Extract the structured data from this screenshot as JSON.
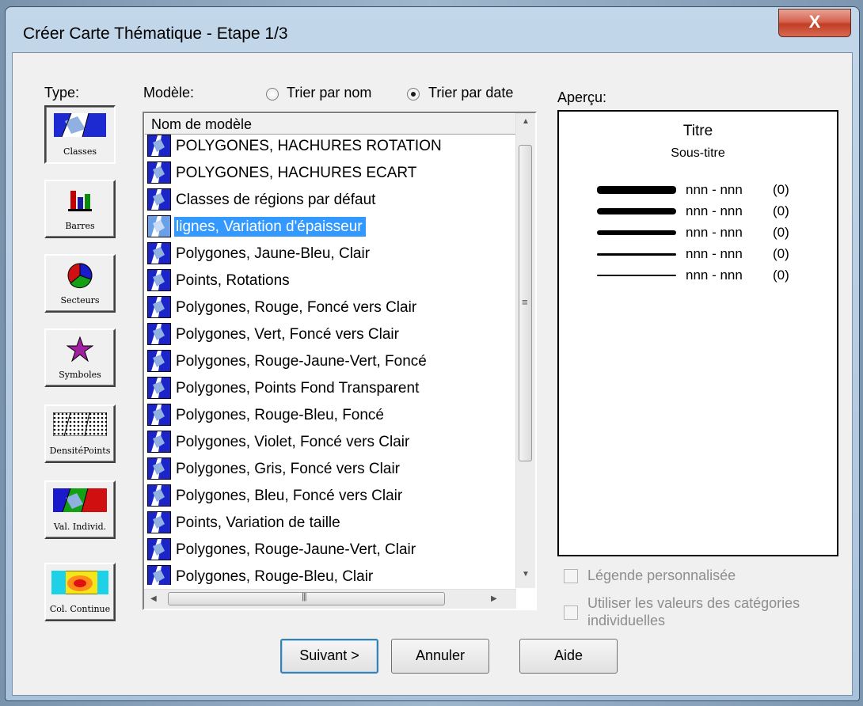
{
  "window": {
    "title": "Créer Carte Thématique - Etape 1/3",
    "close_label": "X"
  },
  "type_label": "Type:",
  "types": [
    {
      "label": "Classes",
      "icon": "classes-icon",
      "pressed": true
    },
    {
      "label": "Barres",
      "icon": "bar-chart-icon"
    },
    {
      "label": "Secteurs",
      "icon": "pie-chart-icon"
    },
    {
      "label": "Symboles",
      "icon": "star-symbol-icon"
    },
    {
      "label": "DensitéPoints",
      "icon": "dot-density-icon"
    },
    {
      "label": "Val. Individ.",
      "icon": "individual-values-icon"
    },
    {
      "label": "Col. Continue",
      "icon": "continuous-color-icon"
    }
  ],
  "model_label": "Modèle:",
  "sort": {
    "by_name": "Trier par nom",
    "by_date": "Trier par date",
    "selected": "by_date"
  },
  "list": {
    "header": "Nom de modèle",
    "items": [
      "POLYGONES, HACHURES ROTATION",
      "POLYGONES, HACHURES ECART",
      "Classes de régions par défaut",
      "lignes, Variation d'épaisseur",
      "Polygones, Jaune-Bleu, Clair",
      "Points, Rotations",
      "Polygones, Rouge, Foncé vers Clair",
      "Polygones, Vert, Foncé vers Clair",
      "Polygones, Rouge-Jaune-Vert, Foncé",
      "Polygones, Points Fond Transparent",
      "Polygones, Rouge-Bleu, Foncé",
      "Polygones, Violet, Foncé vers Clair",
      "Polygones, Gris, Foncé vers Clair",
      "Polygones, Bleu, Foncé vers Clair",
      "Points, Variation de taille",
      "Polygones, Rouge-Jaune-Vert, Clair",
      "Polygones, Rouge-Bleu, Clair"
    ],
    "selected_index": 3
  },
  "preview": {
    "label": "Aperçu:",
    "title": "Titre",
    "subtitle": "Sous-titre",
    "legend": [
      {
        "range": "nnn - nnn",
        "count": "(0)"
      },
      {
        "range": "nnn - nnn",
        "count": "(0)"
      },
      {
        "range": "nnn - nnn",
        "count": "(0)"
      },
      {
        "range": "nnn - nnn",
        "count": "(0)"
      },
      {
        "range": "nnn - nnn",
        "count": "(0)"
      }
    ]
  },
  "options": {
    "custom_legend": "Légende personnalisée",
    "use_category_values": "Utiliser les valeurs des catégories individuelles"
  },
  "buttons": {
    "next": "Suivant >",
    "cancel": "Annuler",
    "help": "Aide"
  }
}
